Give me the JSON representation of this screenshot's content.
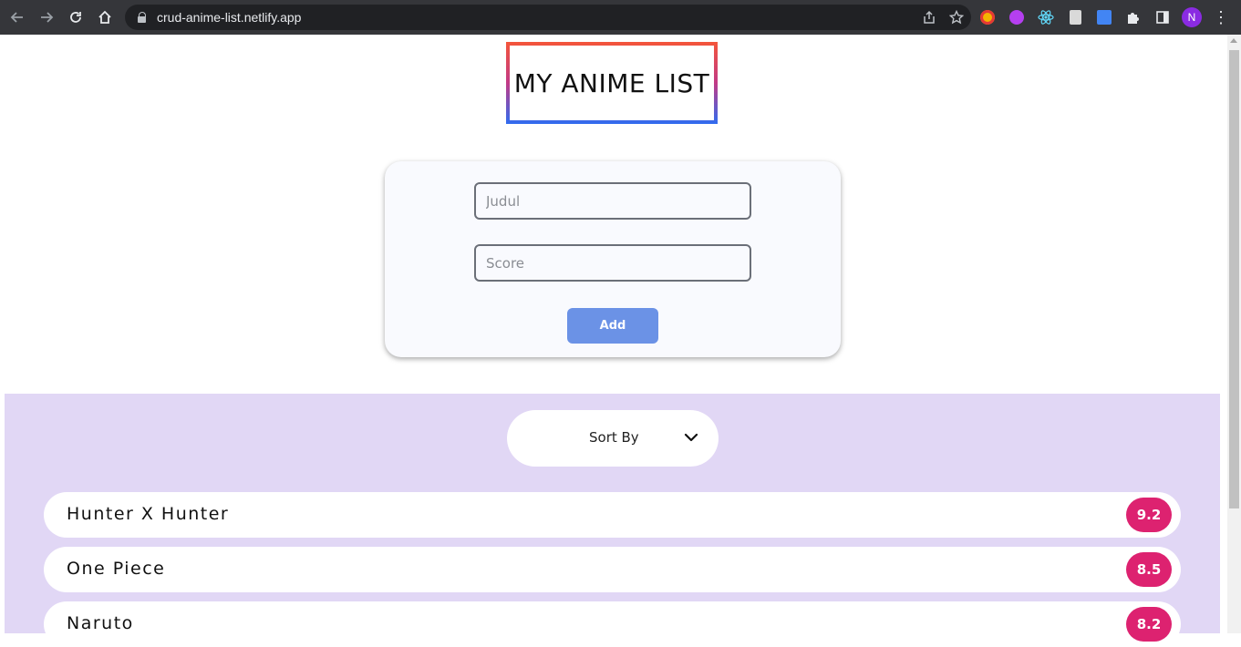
{
  "browser": {
    "url": "crud-anime-list.netlify.app",
    "profile_initial": "N",
    "extensions": [
      {
        "name": "ext-1-icon",
        "color": "#f4b400"
      },
      {
        "name": "ext-2-icon",
        "color": "#b53ff0"
      },
      {
        "name": "react-devtools-icon",
        "color": "#61dafb"
      },
      {
        "name": "ext-4-icon",
        "color": "#d9d9d9"
      },
      {
        "name": "google-translate-icon",
        "color": "#4285f4"
      }
    ]
  },
  "header": {
    "title": "MY ANIME LIST"
  },
  "form": {
    "title_placeholder": "Judul",
    "score_placeholder": "Score",
    "add_label": "Add"
  },
  "list": {
    "sort_label": "Sort By",
    "items": [
      {
        "title": "Hunter X Hunter",
        "score": "9.2"
      },
      {
        "title": "One Piece",
        "score": "8.5"
      },
      {
        "title": "Naruto",
        "score": "8.2"
      }
    ]
  },
  "colors": {
    "accent_button": "#6b92e6",
    "score_badge": "#dd2270",
    "list_background": "#e1d7f5",
    "title_border_top": "#f4553a",
    "title_border_bottom": "#2f6cf0"
  }
}
